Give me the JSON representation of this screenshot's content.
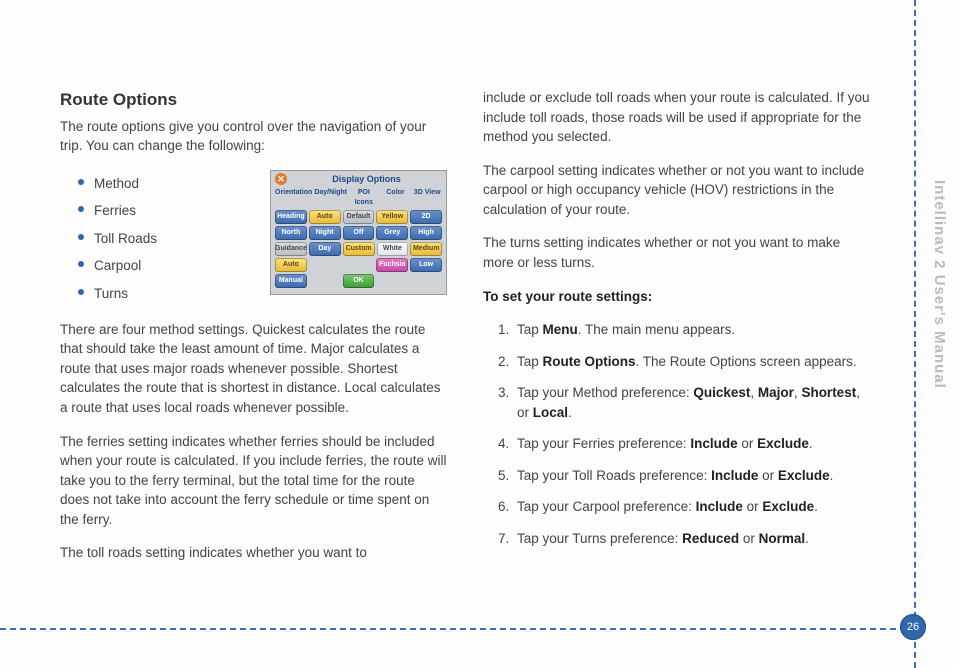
{
  "doc_title": "Intellinav 2 User's Manual",
  "page_number": "26",
  "section_title": "Route Options",
  "intro": "The route options give you control over the navigation of your trip. You can change the following:",
  "bullets": [
    "Method",
    "Ferries",
    "Toll Roads",
    "Carpool",
    "Turns"
  ],
  "para_method": "There are four method settings. Quickest calculates the route that should take the least amount of time. Major calculates a route that uses major roads whenever possible. Shortest calculates the route that is shortest in distance. Local calculates a route that uses local roads whenever possible.",
  "para_ferries": "The ferries setting indicates whether ferries should be included when your route is calculated. If you include ferries, the route will take you to the ferry terminal, but the total time for the route does not take into account the ferry schedule or time spent on the ferry.",
  "para_toll_lead": "The toll roads setting indicates whether you want to",
  "para_toll_cont": "include or exclude toll roads when your route is calculated. If you include toll roads, those roads will be used if appropriate for the method you selected.",
  "para_carpool": "The carpool setting indicates whether or not you want to include carpool or high occupancy vehicle (HOV) restrictions in the calculation of your route.",
  "para_turns": "The turns setting indicates whether or not you want to make more or less turns.",
  "steps_heading": "To set your route settings:",
  "steps": [
    {
      "pre": "Tap ",
      "b1": "Menu",
      "mid": ". The main menu appears."
    },
    {
      "pre": "Tap ",
      "b1": "Route Options",
      "mid": ". The Route Options screen appears."
    },
    {
      "pre": "Tap your Method preference: ",
      "b1": "Quickest",
      "mid": ", ",
      "b2": "Major",
      "mid2": ", ",
      "b3": "Shortest",
      "mid3": ", or ",
      "b4": "Local",
      "tail": "."
    },
    {
      "pre": "Tap your Ferries preference: ",
      "b1": "Include",
      "mid": " or ",
      "b2": "Exclude",
      "tail": "."
    },
    {
      "pre": "Tap your Toll Roads preference: ",
      "b1": "Include",
      "mid": " or ",
      "b2": "Exclude",
      "tail": "."
    },
    {
      "pre": "Tap your Carpool preference: ",
      "b1": "Include",
      "mid": " or ",
      "b2": "Exclude",
      "tail": "."
    },
    {
      "pre": "Tap your Turns preference: ",
      "b1": "Reduced",
      "mid": " or ",
      "b2": "Normal",
      "tail": "."
    }
  ],
  "figure": {
    "title": "Display Options",
    "headers": [
      "Orientation",
      "Day/Night",
      "POI Icons",
      "Color",
      "3D View"
    ],
    "rows": [
      [
        {
          "t": "Heading",
          "c": "b-blue"
        },
        {
          "t": "Auto",
          "c": "b-yellow"
        },
        {
          "t": "Default",
          "c": "b-gray"
        },
        {
          "t": "Yellow",
          "c": "b-yellow"
        },
        {
          "t": "2D",
          "c": "b-blue"
        }
      ],
      [
        {
          "t": "North",
          "c": "b-blue"
        },
        {
          "t": "Night",
          "c": "b-blue"
        },
        {
          "t": "Off",
          "c": "b-blue"
        },
        {
          "t": "Grey",
          "c": "b-blue"
        },
        {
          "t": "High",
          "c": "b-blue"
        }
      ],
      [
        {
          "t": "Guidance",
          "c": "b-gray"
        },
        {
          "t": "Day",
          "c": "b-blue"
        },
        {
          "t": "Custom",
          "c": "b-yellow"
        },
        {
          "t": "White",
          "c": "b-white"
        },
        {
          "t": "Medium",
          "c": "b-yellow"
        }
      ],
      [
        {
          "t": "Auto",
          "c": "b-yellow"
        },
        {
          "t": "",
          "c": ""
        },
        {
          "t": "",
          "c": ""
        },
        {
          "t": "Fuchsia",
          "c": "b-mag"
        },
        {
          "t": "Low",
          "c": "b-blue"
        }
      ],
      [
        {
          "t": "Manual",
          "c": "b-blue"
        },
        {
          "t": "",
          "c": ""
        },
        {
          "t": "OK",
          "c": "b-green"
        },
        {
          "t": "",
          "c": ""
        },
        {
          "t": "",
          "c": ""
        }
      ]
    ]
  }
}
